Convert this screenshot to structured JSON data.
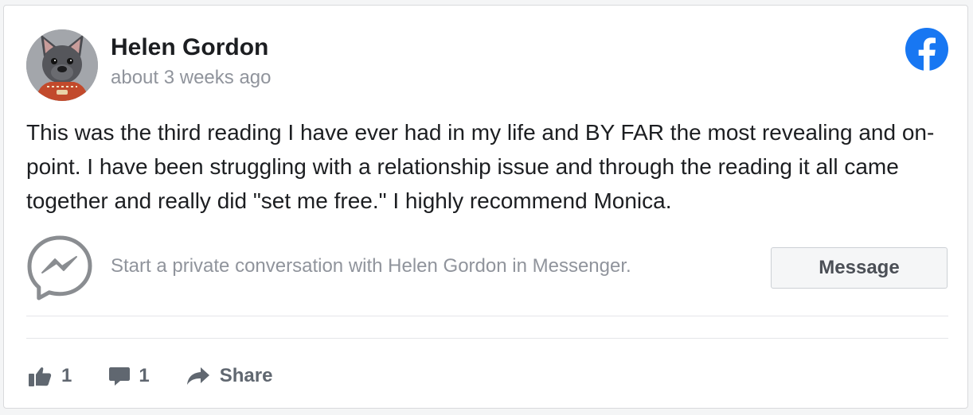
{
  "review": {
    "author_name": "Helen Gordon",
    "posted_time": "about 3 weeks ago",
    "text": "This was the third reading I have ever had in my life and BY FAR the most revealing and on-point. I have been struggling with a relationship issue and through the reading it all came together and really did \"set me free.\" I highly recommend Monica.",
    "source_icon": "facebook-icon"
  },
  "messenger": {
    "prompt": "Start a private conversation with Helen Gordon in Messenger.",
    "button_label": "Message",
    "icon": "messenger-icon"
  },
  "actions": {
    "like_count": "1",
    "comment_count": "1",
    "share_label": "Share"
  },
  "colors": {
    "facebook_blue": "#1877f2",
    "secondary_text": "#90949c",
    "action_gray": "#606770"
  }
}
